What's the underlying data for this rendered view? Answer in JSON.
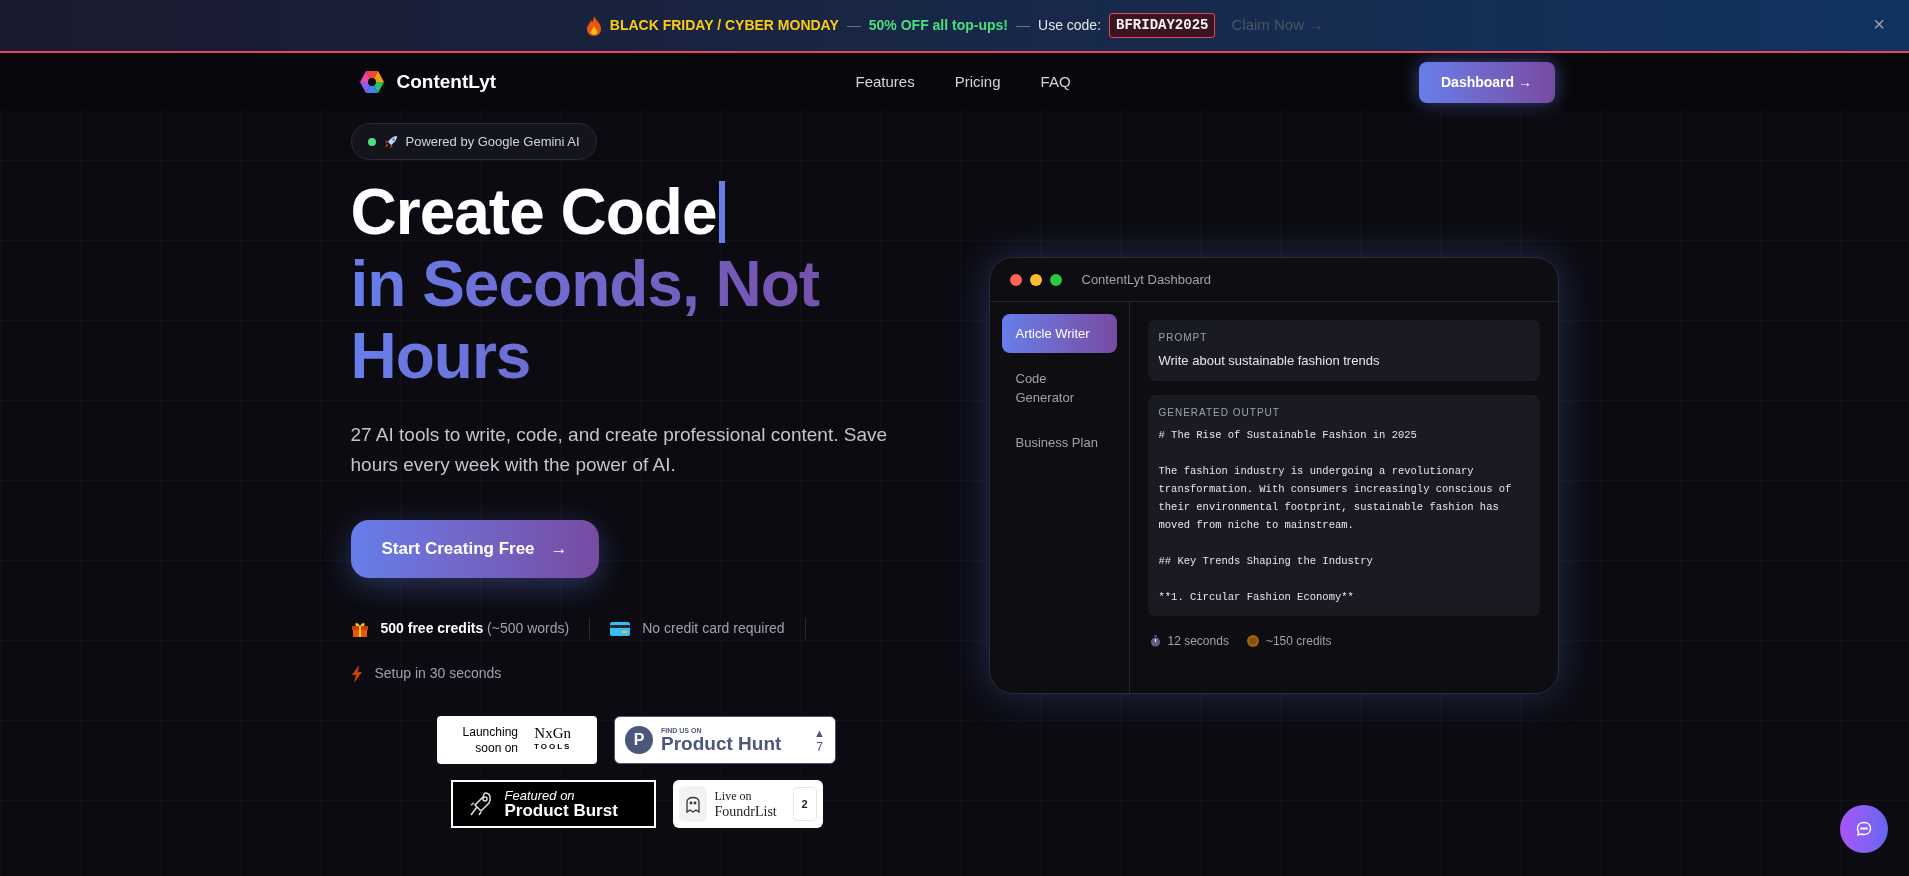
{
  "promo_banner": {
    "headline": "BLACK FRIDAY / CYBER MONDAY",
    "separator_1": "—",
    "offer": "50% OFF all top-ups!",
    "separator_2": "—",
    "code_label": "Use code:",
    "code": "BFRIDAY2025",
    "cta": "Claim Now →",
    "close": "×"
  },
  "navbar": {
    "brand": "ContentLyt",
    "links": [
      "Features",
      "Pricing",
      "FAQ"
    ],
    "button": "Dashboard →"
  },
  "hero": {
    "pill": "Powered by Google Gemini AI",
    "heading_line_1": "Create Code",
    "heading_line_2": "in Seconds, Not Hours",
    "subtitle": "27 AI tools to write, code, and create professional content. Save hours every week with the power of AI.",
    "cta": "Start Creating Free",
    "cta_arrow": "→",
    "perks": [
      {
        "kind": "gift",
        "text": "**500 free credits** (~500 words)"
      },
      {
        "kind": "card",
        "text": "No credit card required"
      },
      {
        "kind": "bolt",
        "text": "Setup in 30 seconds"
      }
    ]
  },
  "badges": [
    {
      "kind": "nxgen",
      "line_1": "Launching",
      "line_2": "soon on",
      "logo": "NxGn",
      "logo_sub": "TOOLS"
    },
    {
      "kind": "producthunt",
      "letter": "P",
      "line_1": "FIND US ON",
      "line_2": "Product Hunt",
      "arrow": "▲",
      "count": "7"
    },
    {
      "kind": "productburst",
      "line_1": "Featured on",
      "line_2": "Product Burst"
    },
    {
      "kind": "foundrlist",
      "line_1": "Live on",
      "line_2": "FoundrList",
      "count": "2"
    }
  ],
  "dashboard": {
    "title": "ContentLyt Dashboard",
    "sidebar": [
      {
        "label": "Article Writer",
        "selected": true
      },
      {
        "label": "Code Generator",
        "selected": false
      },
      {
        "label": "Business Plan",
        "selected": false
      }
    ],
    "prompt_label": "PROMPT",
    "prompt": "Write about sustainable fashion trends",
    "output_label": "GENERATED OUTPUT",
    "output": "# The Rise of Sustainable Fashion in 2025\n\nThe fashion industry is undergoing a revolutionary transformation. With consumers increasingly conscious of their environmental footprint, sustainable fashion has moved from niche to mainstream.\n\n## Key Trends Shaping the Industry\n\n**1. Circular Fashion Economy**",
    "stats": [
      {
        "kind": "time",
        "text": "12 seconds"
      },
      {
        "kind": "credits",
        "text": "~150 credits"
      }
    ]
  }
}
